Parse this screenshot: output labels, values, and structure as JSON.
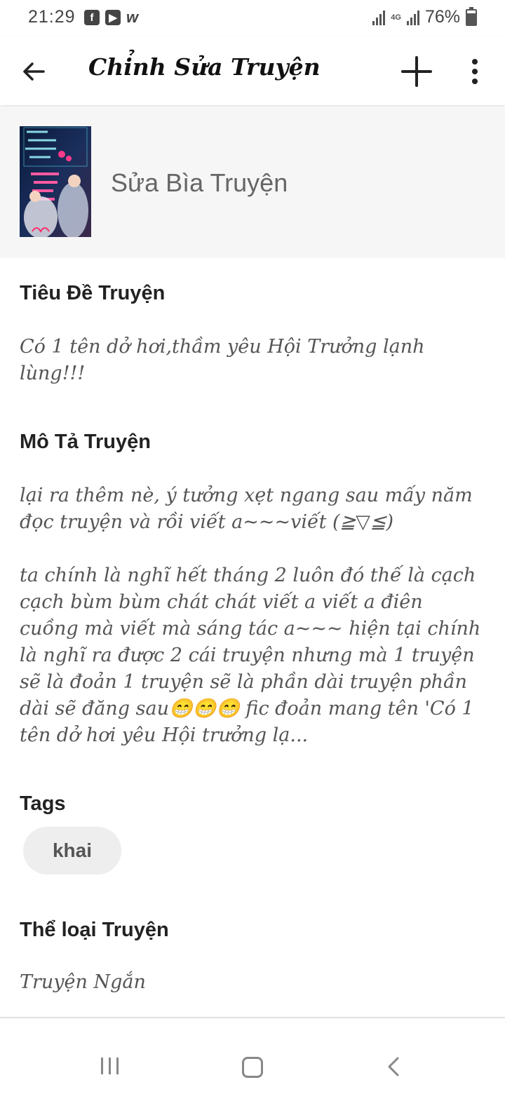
{
  "status": {
    "time": "21:29",
    "network": "4G",
    "battery": "76%",
    "battery_level": 0.76
  },
  "appbar": {
    "title": "Chỉnh Sửa Truyện"
  },
  "cover": {
    "label": "Sửa Bìa Truyện",
    "art_text": "Có 1 tên dở hơi thầm yêu Hội Trưởng lạnh lùng"
  },
  "story": {
    "title_heading": "Tiêu Đề Truyện",
    "title_value": "Có 1 tên dở hơi,thầm yêu Hội Trưởng lạnh lùng!!!",
    "desc_heading": "Mô Tả Truyện",
    "desc_p1": "lại ra thêm nè, ý tưởng xẹt ngang sau mấy năm đọc truyện và rồi viết a~~~viết (≧▽≦)",
    "desc_p2": "ta chính là nghĩ hết tháng 2 luôn đó thế là cạch cạch bùm bùm chát chát viết a viết a điên cuồng mà viết mà sáng tác a~~~ hiện tại chính là nghĩ ra được 2 cái truyện nhưng mà 1 truyện sẽ là đoản 1 truyện sẽ là phần dài truyện phần dài sẽ đăng sau😁😁😁 fic đoản mang tên 'Có 1 tên dở hơi yêu Hội trưởng lạ...",
    "tags_heading": "Tags",
    "tags": [
      "khai"
    ],
    "genre_heading": "Thể loại Truyện",
    "genre_value": "Truyện Ngắn"
  }
}
